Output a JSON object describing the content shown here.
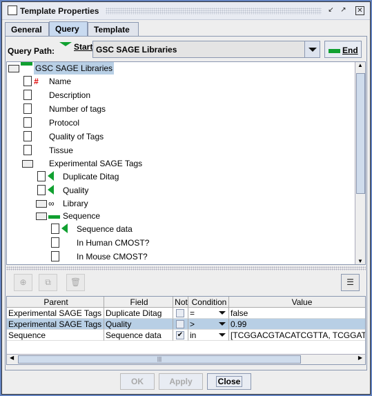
{
  "window": {
    "title": "Template Properties"
  },
  "tabs": [
    {
      "label": "General"
    },
    {
      "label": "Query",
      "selected": true
    },
    {
      "label": "Template"
    }
  ],
  "query": {
    "path_label": "Query Path:",
    "start_label": "Start",
    "start_value": "GSC SAGE Libraries",
    "end_label": "End"
  },
  "tree": [
    {
      "label": "GSC SAGE Libraries",
      "level": 0,
      "icon": "folder",
      "selected": true
    },
    {
      "label": "Name",
      "level": 1,
      "icon": "doc-hash"
    },
    {
      "label": "Description",
      "level": 1,
      "icon": "doc"
    },
    {
      "label": "Number of tags",
      "level": 1,
      "icon": "doc"
    },
    {
      "label": "Protocol",
      "level": 1,
      "icon": "doc"
    },
    {
      "label": "Quality of Tags",
      "level": 1,
      "icon": "doc"
    },
    {
      "label": "Tissue",
      "level": 1,
      "icon": "doc"
    },
    {
      "label": "Experimental SAGE Tags",
      "level": 1,
      "icon": "folder"
    },
    {
      "label": "Duplicate Ditag",
      "level": 2,
      "icon": "doc-constraint"
    },
    {
      "label": "Quality",
      "level": 2,
      "icon": "doc-constraint"
    },
    {
      "label": "Library",
      "level": 2,
      "icon": "folder-link"
    },
    {
      "label": "Sequence",
      "level": 2,
      "icon": "folder-end"
    },
    {
      "label": "Sequence data",
      "level": 3,
      "icon": "doc-constraint"
    },
    {
      "label": "In Human CMOST?",
      "level": 3,
      "icon": "doc"
    },
    {
      "label": "In Mouse CMOST?",
      "level": 3,
      "icon": "doc"
    }
  ],
  "table": {
    "headers": [
      "Parent",
      "Field",
      "Not",
      "Condition",
      "Value"
    ],
    "rows": [
      {
        "parent": "Experimental SAGE Tags",
        "field": "Duplicate Ditag",
        "not": false,
        "condition": "=",
        "value": "false"
      },
      {
        "parent": "Experimental SAGE Tags",
        "field": "Quality",
        "not": false,
        "condition": ">",
        "value": "0.99",
        "selected": true
      },
      {
        "parent": "Sequence",
        "field": "Sequence data",
        "not": true,
        "condition": "in",
        "value": "[TCGGACGTACATCGTTA, TCGGATA"
      }
    ]
  },
  "buttons": {
    "ok": "OK",
    "apply": "Apply",
    "close": "Close"
  },
  "colors": {
    "selection": "#b8cfe5",
    "start_end_marker": "#10a030"
  }
}
